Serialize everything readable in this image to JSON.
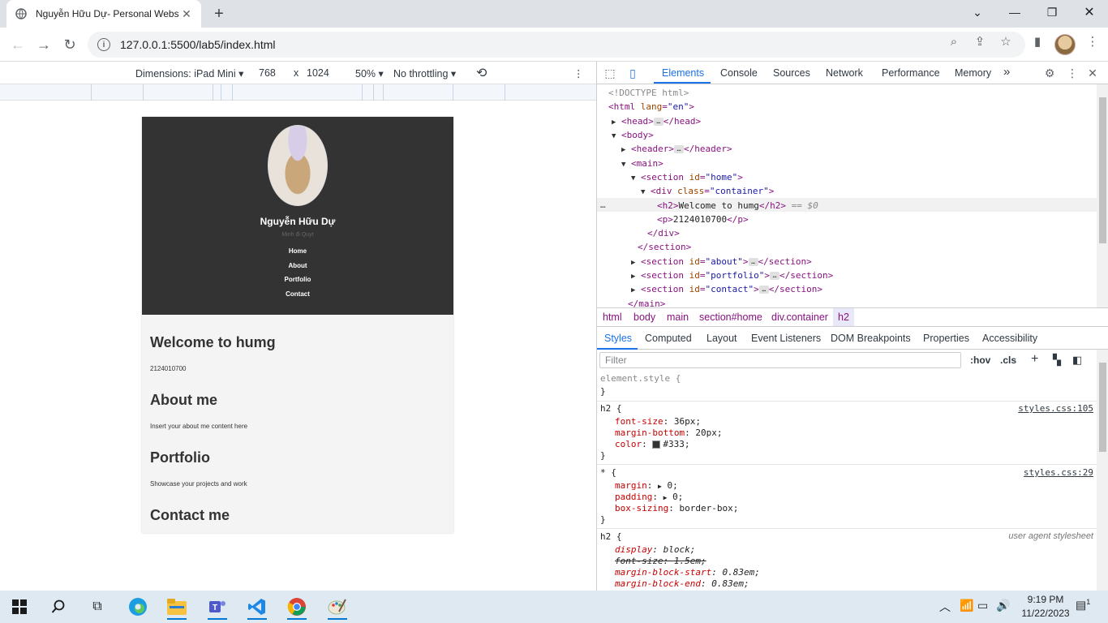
{
  "browser": {
    "tab_title": "Nguyễn Hữu Dự- Personal Webs",
    "url": "127.0.0.1:5500/lab5/index.html"
  },
  "device_toolbar": {
    "dimensions": "Dimensions: iPad Mini",
    "width": "768",
    "times": "x",
    "height": "1024",
    "zoom": "50%",
    "throttling": "No throttling"
  },
  "site": {
    "name": "Nguyễn Hữu Dự",
    "subtitle": "Minh đi Quyt",
    "nav": [
      "Home",
      "About",
      "Portfolio",
      "Contact"
    ],
    "sections": [
      {
        "heading": "Welcome to humg",
        "text": "2124010700"
      },
      {
        "heading": "About me",
        "text": "Insert your about me content here"
      },
      {
        "heading": "Portfolio",
        "text": "Showcase your projects and work"
      },
      {
        "heading": "Contact me",
        "text": ""
      }
    ]
  },
  "devtools": {
    "tabs": [
      "Elements",
      "Console",
      "Sources",
      "Network",
      "Performance",
      "Memory",
      "»"
    ],
    "dom": {
      "doctype": "<!DOCTYPE html>",
      "html_open": "<html",
      "lang_attr": "lang",
      "lang_val": "\"en\"",
      "head": "<head>",
      "head_close": "</head>",
      "body": "<body>",
      "header": "<header>",
      "header_close": "</header>",
      "main": "<main>",
      "section": "<section",
      "id_attr": "id",
      "home_val": "\"home\"",
      "div": "<div",
      "class_attr": "class",
      "container_val": "\"container\"",
      "h2_open": "<h2>",
      "h2_text": "Welcome to humg",
      "h2_close": "</h2>",
      "eq": "== $0",
      "p_open": "<p>",
      "p_text": "2124010700",
      "p_close": "</p>",
      "div_close": "</div>",
      "section_close": "</section>",
      "about_val": "\"about\"",
      "portfolio_val": "\"portfolio\"",
      "contact_val": "\"contact\"",
      "main_close": "</main>"
    },
    "breadcrumbs": [
      "html",
      "body",
      "main",
      "section#home",
      "div.container",
      "h2"
    ],
    "subtabs": [
      "Styles",
      "Computed",
      "Layout",
      "Event Listeners",
      "DOM Breakpoints",
      "Properties",
      "Accessibility"
    ],
    "filter_placeholder": "Filter",
    "hov": ":hov",
    "cls": ".cls",
    "styles": {
      "element_style": "element.style {",
      "close": "}",
      "h2_sel": "h2 {",
      "src1": "styles.css:105",
      "fs_prop": "font-size",
      "fs_val": "36px;",
      "mb_prop": "margin-bottom",
      "mb_val": "20px;",
      "color_prop": "color",
      "color_val": "#333;",
      "star_sel": "* {",
      "src2": "styles.css:29",
      "margin_prop": "margin",
      "margin_val": "0;",
      "padding_prop": "padding",
      "padding_val": "0;",
      "bs_prop": "box-sizing",
      "bs_val": "border-box;",
      "h2_sel2": "h2 {",
      "ua": "user agent stylesheet",
      "display_prop": "display",
      "display_val": "block;",
      "fs2_prop": "font-size",
      "fs2_val": "1.5em;",
      "mbs_prop": "margin-block-start",
      "mbs_val": "0.83em;",
      "mbe_prop": "margin-block-end",
      "mbe_val": "0.83em;"
    }
  },
  "taskbar": {
    "time": "9:19 PM",
    "date": "11/22/2023",
    "notif_count": "1"
  }
}
